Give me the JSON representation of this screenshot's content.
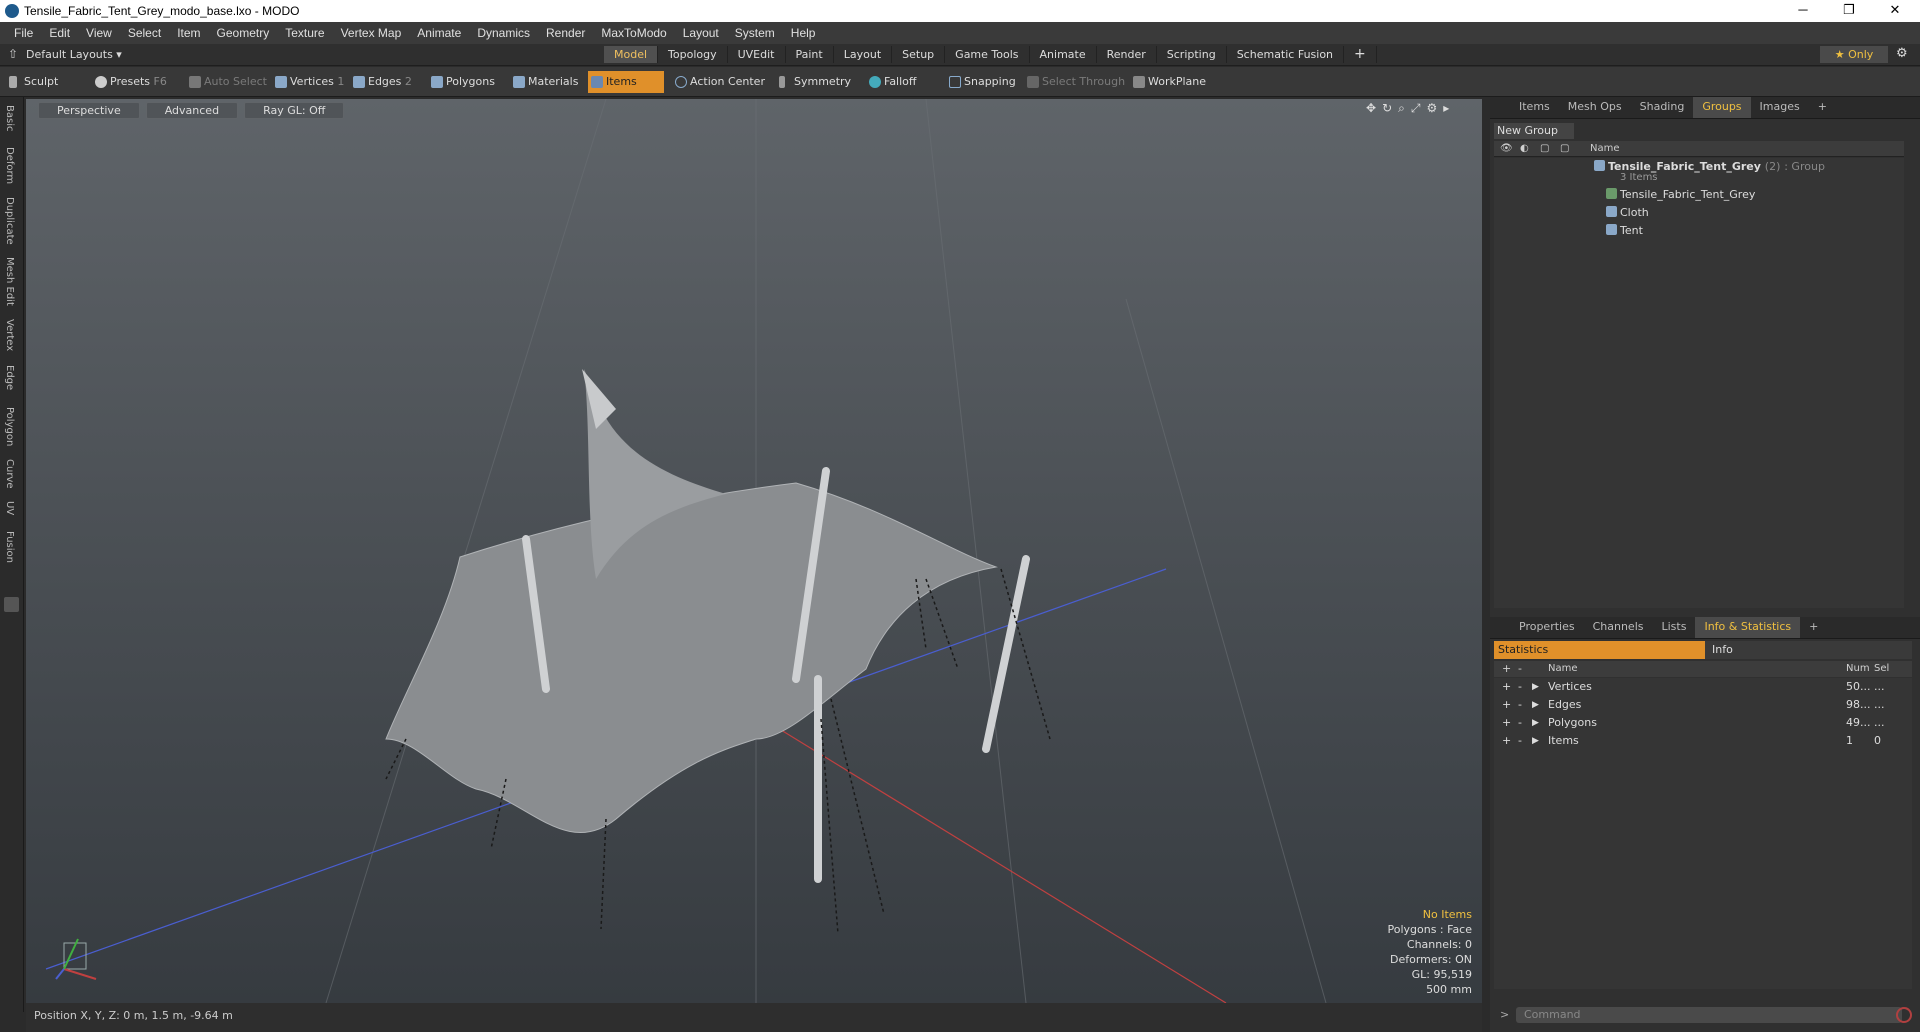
{
  "window": {
    "title": "Tensile_Fabric_Tent_Grey_modo_base.lxo - MODO"
  },
  "menu": [
    "File",
    "Edit",
    "View",
    "Select",
    "Item",
    "Geometry",
    "Texture",
    "Vertex Map",
    "Animate",
    "Dynamics",
    "Render",
    "MaxToModo",
    "Layout",
    "System",
    "Help"
  ],
  "layoutbar": {
    "layout_label": "Default Layouts ▾",
    "tabs": [
      "Model",
      "Topology",
      "UVEdit",
      "Paint",
      "Layout",
      "Setup",
      "Game Tools",
      "Animate",
      "Render",
      "Scripting",
      "Schematic Fusion"
    ],
    "active_tab": "Model",
    "only_label": "★  Only"
  },
  "toolbar": {
    "sculpt": "Sculpt",
    "presets": "Presets",
    "presets_key": "F6",
    "auto_select": "Auto Select",
    "vertices": "Vertices",
    "vertices_num": "1",
    "edges": "Edges",
    "edges_num": "2",
    "polygons": "Polygons",
    "materials": "Materials",
    "items": "Items",
    "action_center": "Action Center",
    "symmetry": "Symmetry",
    "falloff": "Falloff",
    "snapping": "Snapping",
    "select_through": "Select Through",
    "workplane": "WorkPlane"
  },
  "left_tabs": [
    "Basic",
    "Deform",
    "Duplicate",
    "Mesh Edit",
    "Vertex",
    "Edge",
    "Polygon",
    "Curve",
    "UV",
    "Fusion"
  ],
  "viewport": {
    "perspective": "Perspective",
    "advanced": "Advanced",
    "raygl": "Ray GL: Off",
    "info": {
      "no_items": "No Items",
      "polygons": "Polygons : Face",
      "channels": "Channels: 0",
      "deformers": "Deformers: ON",
      "gl": "GL: 95,519",
      "scale": "500 mm"
    }
  },
  "status": {
    "position": "Position X, Y, Z:  0 m, 1.5 m, -9.64 m"
  },
  "groups_panel": {
    "tabs": [
      "Items",
      "Mesh Ops",
      "Shading",
      "Groups",
      "Images"
    ],
    "active_tab": "Groups",
    "new_group": "New Group",
    "col_name": "Name",
    "root": "Tensile_Fabric_Tent_Grey",
    "root_count": "(2)",
    "root_type": ": Group",
    "root_sub": "3 Items",
    "children": [
      "Tensile_Fabric_Tent_Grey",
      "Cloth",
      "Tent"
    ]
  },
  "stats_panel": {
    "tabs": [
      "Properties",
      "Channels",
      "Lists",
      "Info & Statistics"
    ],
    "active_tab": "Info & Statistics",
    "statistics": "Statistics",
    "info": "Info",
    "col_name": "Name",
    "col_num": "Num",
    "col_sel": "Sel",
    "rows": [
      {
        "name": "Vertices",
        "num": "50...",
        "sel": "..."
      },
      {
        "name": "Edges",
        "num": "98...",
        "sel": "..."
      },
      {
        "name": "Polygons",
        "num": "49...",
        "sel": "..."
      },
      {
        "name": "Items",
        "num": "1",
        "sel": "0"
      }
    ]
  },
  "command": {
    "placeholder": "Command"
  }
}
